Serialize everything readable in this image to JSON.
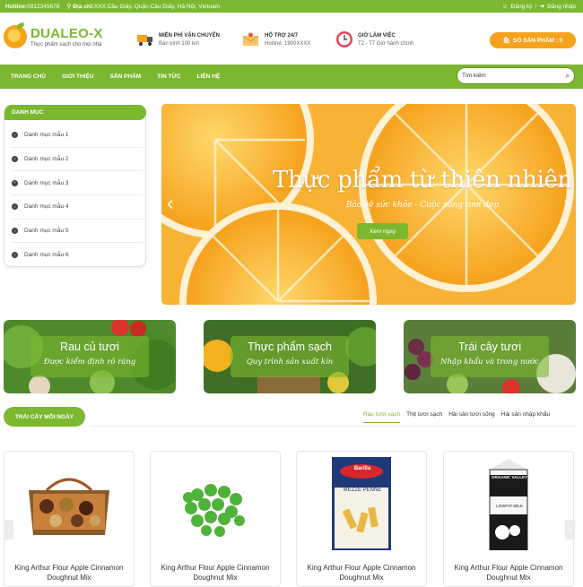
{
  "topbar": {
    "hotline_label": "Hotline:",
    "hotline_value": "0912345678",
    "address_label": "Địa chỉ:",
    "address_value": "XXX Cầu Giấy, Quận Cầu Giấy, Hà Nội, Vietnam",
    "register": "Đăng ký",
    "separator": "/",
    "login": "Đăng nhập"
  },
  "header": {
    "logo_title": "DUALEO-X",
    "logo_sub": "Thực phẩm sạch cho mọi nhà",
    "features": [
      {
        "title": "MIỄN PHÍ VẬN CHUYỂN",
        "sub": "Bán kính 100 km",
        "icon": "truck-icon"
      },
      {
        "title": "HỖ TRỢ 24/7",
        "sub": "Hotline: 1900XXXX",
        "icon": "mail-icon"
      },
      {
        "title": "GIỜ LÀM VIỆC",
        "sub": "T2 - T7 Giờ hành chính",
        "icon": "clock-icon"
      }
    ],
    "cart_label": "SỐ SẢN PHẨM : 0"
  },
  "nav": {
    "items": [
      "TRANG CHỦ",
      "GIỚI THIỆU",
      "SẢN PHẨM",
      "TIN TỨC",
      "LIÊN HỆ"
    ],
    "search_placeholder": "Tìm kiếm"
  },
  "sidebar": {
    "title": "DANH MỤC",
    "items": [
      "Danh mục mẫu 1",
      "Danh mục mẫu 2",
      "Danh mục mẫu 3",
      "Danh mục mẫu 4",
      "Danh mục mẫu 5",
      "Danh mục mẫu 6"
    ]
  },
  "slider": {
    "title": "Thực phẩm từ thiên nhiên",
    "subtitle": "Bảo vệ sức khỏe - Cuộc sống tươi đẹp",
    "button": "Xem ngay",
    "prev": "‹",
    "next": "›"
  },
  "banners": [
    {
      "title": "Rau củ tươi",
      "sub": "Được kiểm định rõ ràng"
    },
    {
      "title": "Thực phẩm sạch",
      "sub": "Quy trình sản xuất kín"
    },
    {
      "title": "Trái cây tươi",
      "sub": "Nhập khẩu và trong nước"
    }
  ],
  "section": {
    "title": "TRÁI CÂY MỖI NGÀY",
    "tabs": [
      "Rau tươi sạch",
      "Thịt tươi sạch",
      "Hải sản tươi sống",
      "Hải sản nhập khẩu"
    ]
  },
  "products": [
    {
      "name": "King Arthur Flour Apple Cinnamon Doughnut Mix"
    },
    {
      "name": "King Arthur Flour Apple Cinnamon Doughnut Mix"
    },
    {
      "name": "King Arthur Flour Apple Cinnamon Doughnut Mix",
      "brand": "Barilla",
      "product": "MEZZE PENNE"
    },
    {
      "name": "King Arthur Flour Apple Cinnamon Doughnut Mix",
      "brand": "ORGANIC VALLEY",
      "product": "LOWFAT MILK"
    }
  ],
  "colors": {
    "accent": "#7cb82f",
    "orange": "#f6a21d"
  }
}
